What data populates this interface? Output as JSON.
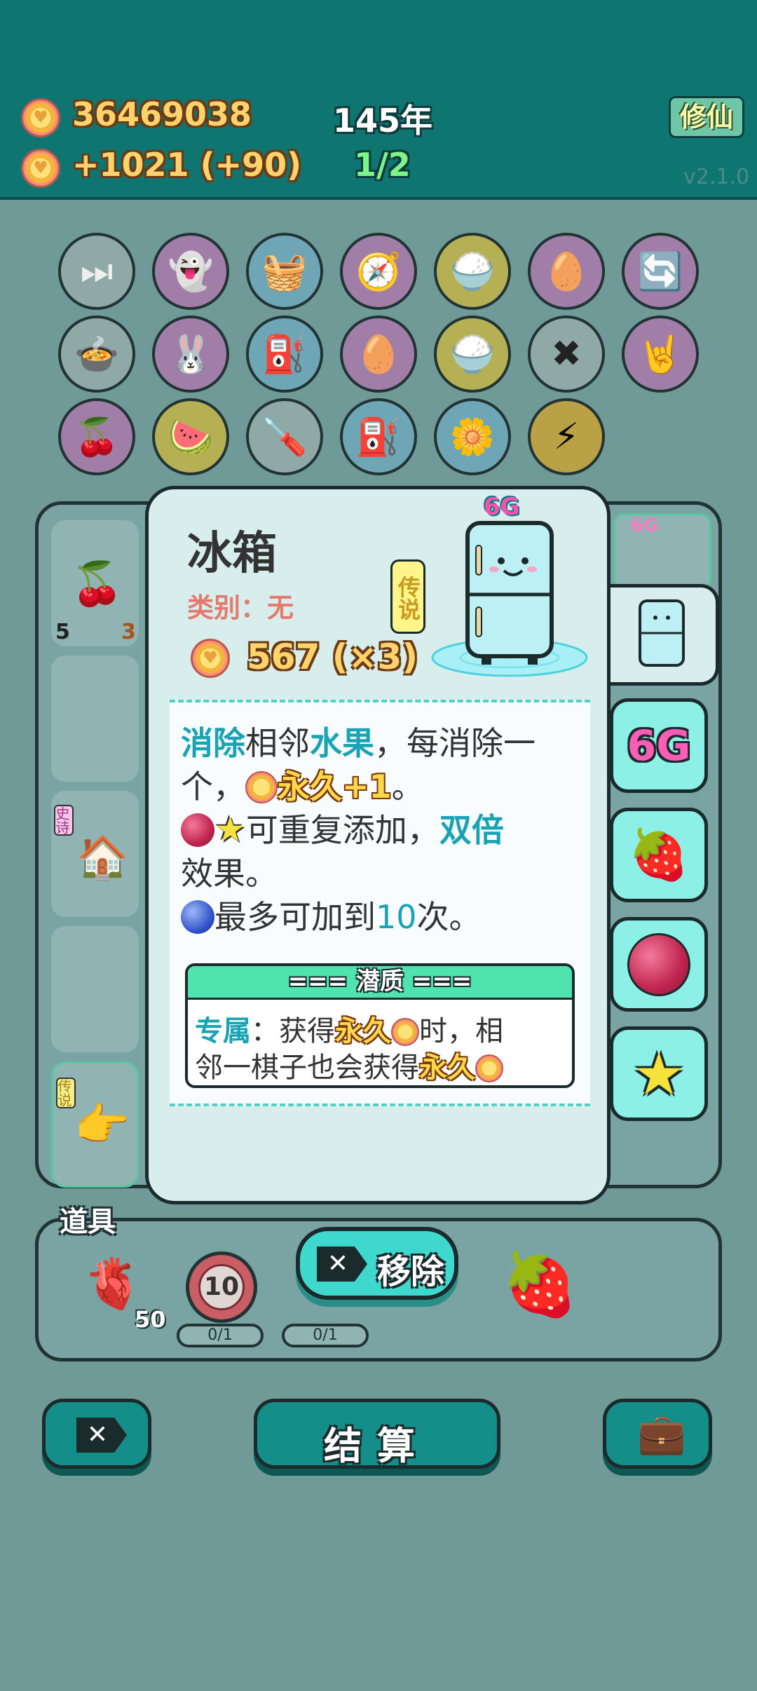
{
  "header": {
    "coins": "36469038",
    "income": "+1021 (+90)",
    "year": "145年",
    "progress": "1/2",
    "xiuxian_button": "修仙",
    "version": "v2.1.0"
  },
  "toolbar_icons": [
    "skip-icon",
    "ghost-icon",
    "fruit-basket-icon",
    "compass-icon",
    "rice-bowl-icon",
    "egg-bag-icon",
    "refresh-icon",
    "pot-duck-icon",
    "rabbit-icon",
    "pump-icon",
    "egg-bag-icon",
    "rice-bowl-icon",
    "remove-tag-icon",
    "rock-hand-icon",
    "cherries-icon",
    "fruit-plate-icon",
    "screwdriver-icon",
    "pump-icon",
    "flower-pot-icon",
    "lightning-icon"
  ],
  "board": {
    "cell_count_left": "5",
    "cell_count_right": "3",
    "tag_epic": "史诗",
    "tag_legend": "传说"
  },
  "tools": {
    "label": "道具",
    "liver_count": "50",
    "target_value": "10",
    "slot1_progress": "0/1",
    "slot2_progress": "0/1"
  },
  "bottom": {
    "settle_label": "结算"
  },
  "modal": {
    "title": "冰箱",
    "category": "类别：无",
    "price": "567 (×3)",
    "rarity": "传说",
    "tier_badge": "6G",
    "desc": {
      "l1_a": "消除",
      "l1_b": "相邻",
      "l1_c": "水果",
      "l1_d": "，每消除一",
      "l2_a": "个，",
      "l2_b": "永久+1",
      "l2_c": "。",
      "l3_a": "可重复添加，",
      "l3_b": "双倍",
      "l4": "效果。",
      "l5_a": "最多可加到",
      "l5_b": "10",
      "l5_c": "次。"
    },
    "potential": {
      "heading": "=== 潜质 ===",
      "l1_a": "专属",
      "l1_b": "：获得",
      "l1_c": "永久",
      "l1_d": "时，相",
      "l2_a": "邻一棋子也会获得",
      "l2_b": "永久"
    }
  },
  "side_tabs": {
    "tier_label": "6G",
    "small_tier_label": "6G"
  },
  "remove_button": {
    "label": "移除"
  },
  "colors": {
    "header_bg": "#0f7571",
    "accent_teal": "#1aa3b5",
    "gold_text": "#ffd84a",
    "category_red": "#e57a6e"
  }
}
